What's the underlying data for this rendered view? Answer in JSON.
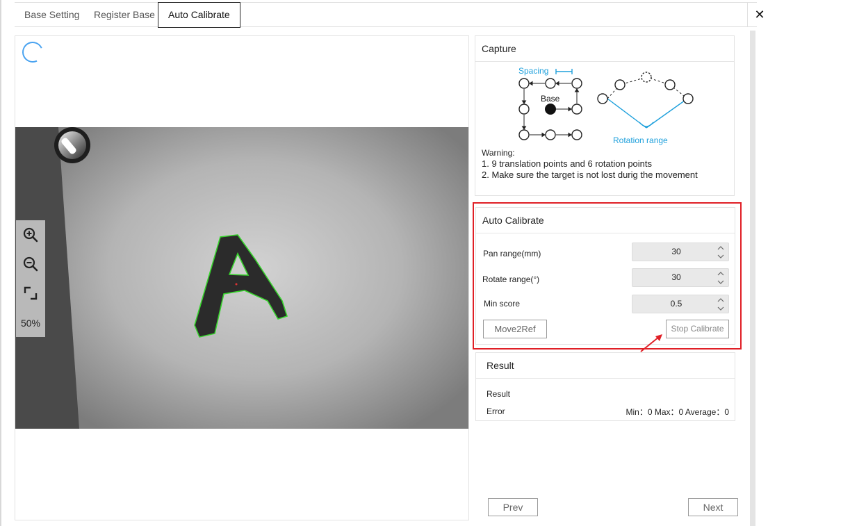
{
  "tabs": [
    {
      "label": "Base Setting"
    },
    {
      "label": "Register Base"
    },
    {
      "label": "Auto Calibrate",
      "active": true
    }
  ],
  "close_symbol": "✕",
  "viewer": {
    "zoom_level": "50%",
    "tools": [
      "zoom-in-icon",
      "zoom-out-icon",
      "fit-to-screen-icon"
    ],
    "image_letter": "A"
  },
  "capture": {
    "title": "Capture",
    "diagram": {
      "spacing_label": "Spacing",
      "base_label": "Base",
      "rotation_label": "Rotation range"
    },
    "warning_title": "Warning:",
    "warnings": [
      {
        "num": "1.",
        "text": "9 translation points and 6 rotation points"
      },
      {
        "num": "2.",
        "text": "Make sure the target is not lost durig the movement"
      }
    ]
  },
  "auto_calibrate": {
    "title": "Auto Calibrate",
    "fields": [
      {
        "label": "Pan range(mm)",
        "value": "30"
      },
      {
        "label": "Rotate range(°)",
        "value": "30"
      },
      {
        "label": "Min score",
        "value": "0.5"
      }
    ],
    "move_button": "Move2Ref",
    "stop_button": "Stop Calibrate"
  },
  "result": {
    "title": "Result",
    "result_label": "Result",
    "error_label": "Error",
    "stats": "Min：0 Max：0 Average：0"
  },
  "navigation": {
    "prev": "Prev",
    "next": "Next"
  },
  "colors": {
    "accent_blue": "#1ea0dc",
    "highlight_red": "#e01f26",
    "contour_green": "#37d42c"
  }
}
